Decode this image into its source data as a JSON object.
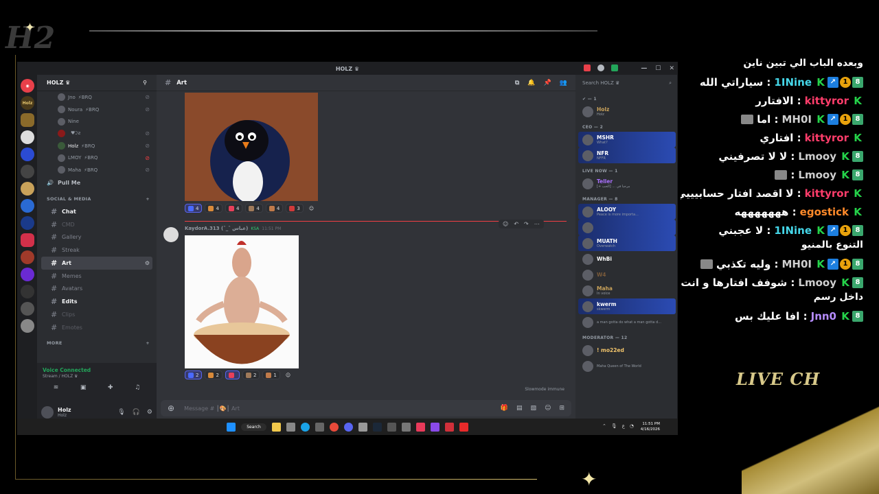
{
  "window": {
    "title": "HOLZ ♛"
  },
  "servers": [
    "Holz"
  ],
  "guild": {
    "name": "HOLZ ♛"
  },
  "voice_users": [
    {
      "name": "Jno",
      "tag": "⚡BRQ",
      "red": false
    },
    {
      "name": "Noura",
      "tag": "⚡BRQ",
      "red": false
    },
    {
      "name": "Nine",
      "tag": "",
      "red": false
    },
    {
      "name": "",
      "tag": "♥੨ƨ",
      "red": false
    },
    {
      "name": "Holz",
      "tag": "⚡BRQ",
      "red": false
    },
    {
      "name": "LMOY",
      "tag": "⚡BRQ",
      "red": true
    },
    {
      "name": "Maha",
      "tag": "⚡BRQ",
      "red": false
    }
  ],
  "voice_channel": "Pull Me",
  "category": "SOCIAL & MEDIA",
  "channels": [
    {
      "name": "Chat",
      "state": "bright"
    },
    {
      "name": "CMD",
      "state": "muted"
    },
    {
      "name": "Gallery",
      "state": "normal"
    },
    {
      "name": "Streak",
      "state": "normal"
    },
    {
      "name": "Art",
      "state": "active"
    },
    {
      "name": "Memes",
      "state": "normal"
    },
    {
      "name": "Avatars",
      "state": "normal"
    },
    {
      "name": "Edits",
      "state": "bright"
    },
    {
      "name": "Clips",
      "state": "muted"
    },
    {
      "name": "Emotes",
      "state": "muted"
    }
  ],
  "more_category": "MORE",
  "voice_status": {
    "title": "Voice Connected",
    "sub": "Stream / HOLZ ♛"
  },
  "user": {
    "name": "Holz",
    "status": "Holz"
  },
  "channel_header": {
    "name": "Art"
  },
  "reactions_1": [
    "4",
    "4",
    "4",
    "4",
    "4",
    "3"
  ],
  "message": {
    "author": "KaydorA.313 (ˆ_ˆ عباس)",
    "tag": "KSA",
    "time": "11:51 PM"
  },
  "reactions_2": [
    "2",
    "2",
    "",
    "2",
    "1"
  ],
  "slowmode": "Slowmode immune",
  "composer": {
    "placeholder": "Message # ┃🎨┃ Art"
  },
  "members_search": "Search HOLZ ♛",
  "member_groups": [
    {
      "label": "✔ — 1",
      "members": [
        {
          "name": "Holz",
          "sub": "Holz",
          "color": "#c9a25a",
          "banner": false
        }
      ]
    },
    {
      "label": "CEO — 2",
      "members": [
        {
          "name": "MSHR",
          "sub": "What?",
          "color": "#ffffff",
          "banner": true
        },
        {
          "name": "NFR",
          "sub": "NFFR",
          "color": "#ffffff",
          "banner": true
        }
      ]
    },
    {
      "label": "LIVE NOW — 1",
      "members": [
        {
          "name": "Teller",
          "sub": "[+ الحب] ... مرحبا في",
          "color": "#a970ff",
          "banner": false
        }
      ]
    },
    {
      "label": "MANAGER — 8",
      "members": [
        {
          "name": "ALOOY",
          "sub": "Peace is more importa...",
          "color": "#ffffff",
          "banner": true
        },
        {
          "name": "",
          "sub": "",
          "color": "#ffffff",
          "banner": true
        },
        {
          "name": "MUATH",
          "sub": "Overwatch",
          "color": "#ffffff",
          "banner": true
        },
        {
          "name": "WhBi",
          "sub": "",
          "color": "#ffffff",
          "banner": false
        },
        {
          "name": "W4",
          "sub": "",
          "color": "#7a5a3a",
          "banner": false
        },
        {
          "name": "Maha",
          "sub": "In voice",
          "color": "#c9a25a",
          "banner": false
        },
        {
          "name": "kwerm",
          "sub": "skwerm",
          "color": "#ffffff",
          "banner": true
        },
        {
          "name": "",
          "sub": "a man gotta do what a man gotta d...",
          "color": "#ffffff",
          "banner": false
        }
      ]
    },
    {
      "label": "MODERATOR — 12",
      "members": [
        {
          "name": "! mo22ed",
          "sub": "",
          "color": "#f0c36a",
          "banner": false
        },
        {
          "name": "",
          "sub": "Maha Queen of The World",
          "color": "#ffffff",
          "banner": false
        }
      ]
    }
  ],
  "taskbar": {
    "search": "Search",
    "time": "11:51 PM",
    "date": "4/16/2026",
    "lang": "ع"
  },
  "chat": [
    {
      "user": "",
      "color": "#ffffff",
      "badges": [],
      "text": "وبعده الباب الي تبين ناين"
    },
    {
      "user": "1INine",
      "color": "#45d6e8",
      "badges": [
        "K",
        "arrow",
        "1",
        "8"
      ],
      "text": ": سياراتي الله"
    },
    {
      "user": "kittyror",
      "color": "#ff3d6b",
      "badges": [
        "K"
      ],
      "text": ": الافتارر"
    },
    {
      "user": "MH0I",
      "color": "#cfcfcf",
      "badges": [
        "K",
        "arrow",
        "1",
        "8"
      ],
      "text": ": اما"
    },
    {
      "user": "kittyror",
      "color": "#ff3d6b",
      "badges": [
        "K"
      ],
      "text": ": افتاري"
    },
    {
      "user": "Lmooy",
      "color": "#cfcfcf",
      "badges": [
        "K",
        "8"
      ],
      "text": ": لا لا تصرفيني"
    },
    {
      "user": "Lmooy",
      "color": "#cfcfcf",
      "badges": [
        "K",
        "8"
      ],
      "text": ":"
    },
    {
      "user": "kittyror",
      "color": "#ff3d6b",
      "badges": [
        "K"
      ],
      "text": ": لا اقصد افتار حسابيييي"
    },
    {
      "user": "egostick",
      "color": "#ff8a2a",
      "badges": [
        "K"
      ],
      "text": ": هههههههه"
    },
    {
      "user": "1INine",
      "color": "#45d6e8",
      "badges": [
        "K",
        "arrow",
        "1",
        "8"
      ],
      "text": ": لا عجبني"
    },
    {
      "user": "",
      "color": "#ffffff",
      "badges": [],
      "text": "التنوع بالمنيو"
    },
    {
      "user": "MH0I",
      "color": "#cfcfcf",
      "badges": [
        "K",
        "arrow",
        "1",
        "8"
      ],
      "text": ": وليه تكذبي"
    },
    {
      "user": "Lmooy",
      "color": "#cfcfcf",
      "badges": [
        "K",
        "8"
      ],
      "text": ": شوفف افتارها و انت"
    },
    {
      "user": "",
      "color": "#ffffff",
      "badges": [],
      "text": "داخل رسم"
    },
    {
      "user": "Jnn0",
      "color": "#b68cff",
      "badges": [
        "K",
        "8"
      ],
      "text": ": افا عليك بس"
    }
  ],
  "live_chat_label": "LIVE CH",
  "colors": {
    "discord_bg": "#313338",
    "accent": "#5865f2",
    "online": "#23a55a"
  }
}
